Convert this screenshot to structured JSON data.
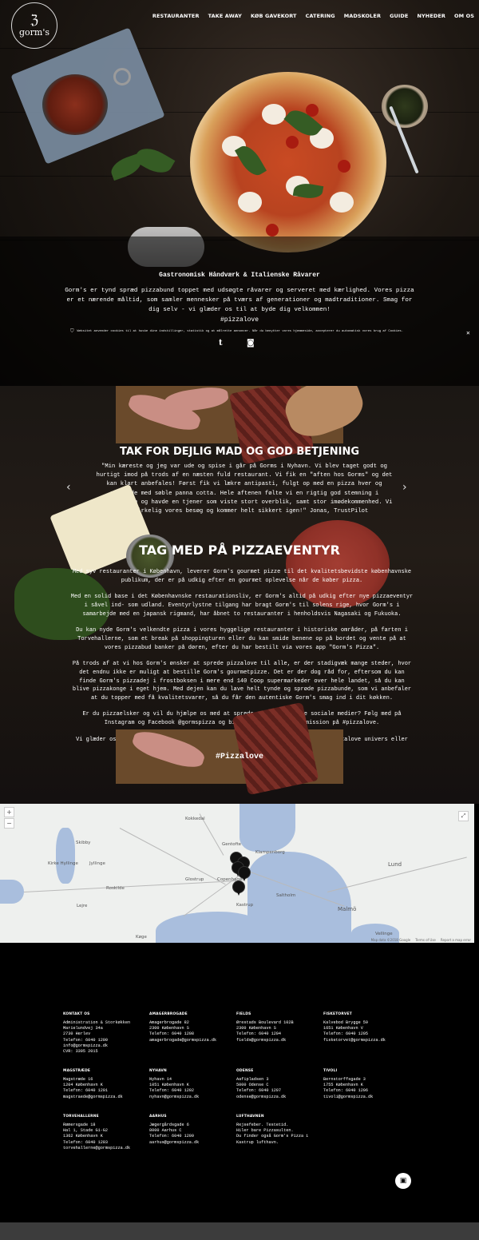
{
  "brand": {
    "logo_text": "gorm's"
  },
  "nav": {
    "items": [
      {
        "label": "RESTAURANTER"
      },
      {
        "label": "TAKE AWAY"
      },
      {
        "label": "KØB GAVEKORT"
      },
      {
        "label": "CATERING"
      },
      {
        "label": "MADSKOLER"
      },
      {
        "label": "GUIDE"
      },
      {
        "label": "NYHEDER"
      },
      {
        "label": "OM OS"
      }
    ]
  },
  "hero": {
    "title": "Gastronomisk Håndværk & Italienske Råvarer",
    "text": "Gorm's er tynd spræd pizzabund toppet med udsøgte råvarer og serveret med kærlighed. Vores pizza er et nærende måltid, som samler mennesker på tværs af generationer og madtraditioner. Smag for dig selv - vi glæder os til at byde dig velkommen!",
    "hashtag": "#pizzalove",
    "cookie_text": "Websitet anvender cookies til at huske dine indstillinger, statistik og at målrette annoncer. Når du benytter vores hjemmeside, accepterer du automatisk vores brug af Cookies.",
    "close_symbol": "✕"
  },
  "social": {
    "tumblr_symbol": "t",
    "instagram_symbol": "◙"
  },
  "testimonial": {
    "heading": "TAK FOR DEJLIG MAD OG GOD BETJENING",
    "quote": "\"Min kæreste og jeg var ude og spise i går på Gorms i Nyhavn. Vi blev taget godt og hurtigt imod på trods af en næsten fuld restaurant. Vi fik en \"aften hos Gorms\" og det kan klart anbefales! Først fik vi lækre antipasti, fulgt op med en pizza hver og sluttede med søble panna cotta. Hele aftenen følte vi en rigtig god stemning i restauranten og havde en tjener som viste stort overblik, samt stor imødekommenhed. Vi var virkelig vores besøg og kommer helt sikkert igen!\" Jonas, TrustPilot",
    "prev_arrow": "‹",
    "next_arrow": "›"
  },
  "adventure": {
    "heading": "TAG MED PÅ PIZZAEVENTYR",
    "paragraphs": [
      "Med syv restauranter i København, leverer Gorm's gourmet pizze til det kvalitetsbevidste københavnske publikum, der er på udkig efter en gourmet oplevelse når de køber pizza.",
      "Med en solid base i det Københavnske restaurationsliv, er Gorm's altid på udkig efter nye pizzaeventyr i såvel ind- som udland. Eventyrlystne tilgang har bragt Gorm's til solens rige, hvor Gorm's i samarbejde med en japansk rigmand, har åbnet to restauranter i henholdsvis Nagasaki og Fukuoka.",
      "Du kan nyde Gorm's velkendte pizza i vores hyggelige restauranter i historiske områder, på farten i Torvehallerne, som et break på shoppingturen eller du kan smide benene op på bordet og vente på at vores pizzabud banker på døren, efter du har bestilt via vores app \"Gorm's Pizza\".",
      "På trods af at vi hos Gorm's ønsker at sprede pizzalove til alle, er der stadigvæk mange steder, hvor det endnu ikke er muligt at bestille Gorm's gourmetpizze. Det er der dog råd for, eftersom du kan finde Gorm's pizzadej i frostboksen i mere end 140 Coop supermarkeder over hele landet, så du kan blive pizzakonge i eget hjem. Med dejen kan du lave helt tynde og sprøde pizzabunde, som vi anbefaler at du topper med få kvalitetsvarer, så du får den autentiske Gorm's smag ind i dit køkken.",
      "Er du pizzaelsker og vil du hjælpe os med at sprede pizzalove på de sociale medier? Følg med på Instagram og Facebook @gormspizza og bidrag gerne til vores mission på #pizzalove.",
      "Vi glæder os til at byde dig velkommen på en af vores restauranter, i vores pizzalove univers eller til at bringe pizza til din dør."
    ],
    "hashtag": "#Pizzalove"
  },
  "map": {
    "zoom_in": "+",
    "zoom_out": "−",
    "fullscreen": "⤢",
    "places": [
      {
        "label": "Kokkedal"
      },
      {
        "label": "Gentofte"
      },
      {
        "label": "Klampenborg"
      },
      {
        "label": "Copenhagen"
      },
      {
        "label": "Roskilde"
      },
      {
        "label": "Glostrup"
      },
      {
        "label": "Kastrup"
      },
      {
        "label": "Saltholm"
      },
      {
        "label": "Malmö"
      },
      {
        "label": "Lund"
      },
      {
        "label": "Vellinge"
      },
      {
        "label": "Køge"
      },
      {
        "label": "Skibby"
      },
      {
        "label": "Kirke Hyllinge"
      },
      {
        "label": "Jyllinge"
      },
      {
        "label": "Lejre"
      }
    ],
    "footer_links": [
      "Map data ©2018 Google",
      "Terms of Use",
      "Report a map error"
    ]
  },
  "footer": {
    "columns": [
      {
        "title": "KONTAKT OS",
        "lines": [
          "Administration & Storkøkken",
          "Marielundvej 34a",
          "2730 Herlev",
          "Telefon: 6040 1200",
          "info@gormspizza.dk",
          "CVR: 3395 2015"
        ]
      },
      {
        "title": "AMAGERBROGADE",
        "lines": [
          "Amagerbrogade 82",
          "2300 København S",
          "Telefon: 6040 1208",
          "amagerbrogade@gormspizza.dk"
        ]
      },
      {
        "title": "FIELDS",
        "lines": [
          "Ørestads Boulevard 102B",
          "2300 København S",
          "Telefon: 6040 1204",
          "fields@gormspizza.dk"
        ]
      },
      {
        "title": "FISKETORVET",
        "lines": [
          "Kalvebod Brygge 59",
          "1651 København V",
          "Telefon: 6040 1205",
          "fisketorvet@gormspizza.dk"
        ]
      },
      {
        "title": "MAGSTRÆDE",
        "lines": [
          "Magstræde 16",
          "1204 København K",
          "Telefon: 6040 1201",
          "magstraede@gormspizza.dk"
        ]
      },
      {
        "title": "NYHAVN",
        "lines": [
          "Nyhavn 14",
          "1051 København K",
          "Telefon: 6040 1202",
          "nyhavn@gormspizza.dk"
        ]
      },
      {
        "title": "ODENSE",
        "lines": [
          "Aafipladsen 3",
          "5000 Odense C",
          "Telefon: 6040 1207",
          "odense@gormspizza.dk"
        ]
      },
      {
        "title": "TIVOLI",
        "lines": [
          "Bernstorffsgade 3",
          "1755 København K",
          "Telefon: 6040 1206",
          "tivoli@gormspizza.dk"
        ]
      },
      {
        "title": "TORVEHALLERNE",
        "lines": [
          "Rømersgade 18",
          "Hal 1, Stade G1-G2",
          "1362 København K",
          "Telefon: 6040 1203",
          "torvehallerne@gormspizza.dk"
        ]
      },
      {
        "title": "AARHUS",
        "lines": [
          "Jægergårdsgade 6",
          "8000 Aarhus C",
          "Telefon: 6040 1209",
          "aarhus@gormspizza.dk"
        ]
      },
      {
        "title": "LUFTHAVNEN",
        "lines": [
          "Rejsefeber. Testetid.",
          "Hiler bare Pizzasulten.",
          "Du finder også Gorm's Pizza i",
          "Kastrup lufthavn."
        ]
      }
    ],
    "icon_glyph": "▣"
  }
}
